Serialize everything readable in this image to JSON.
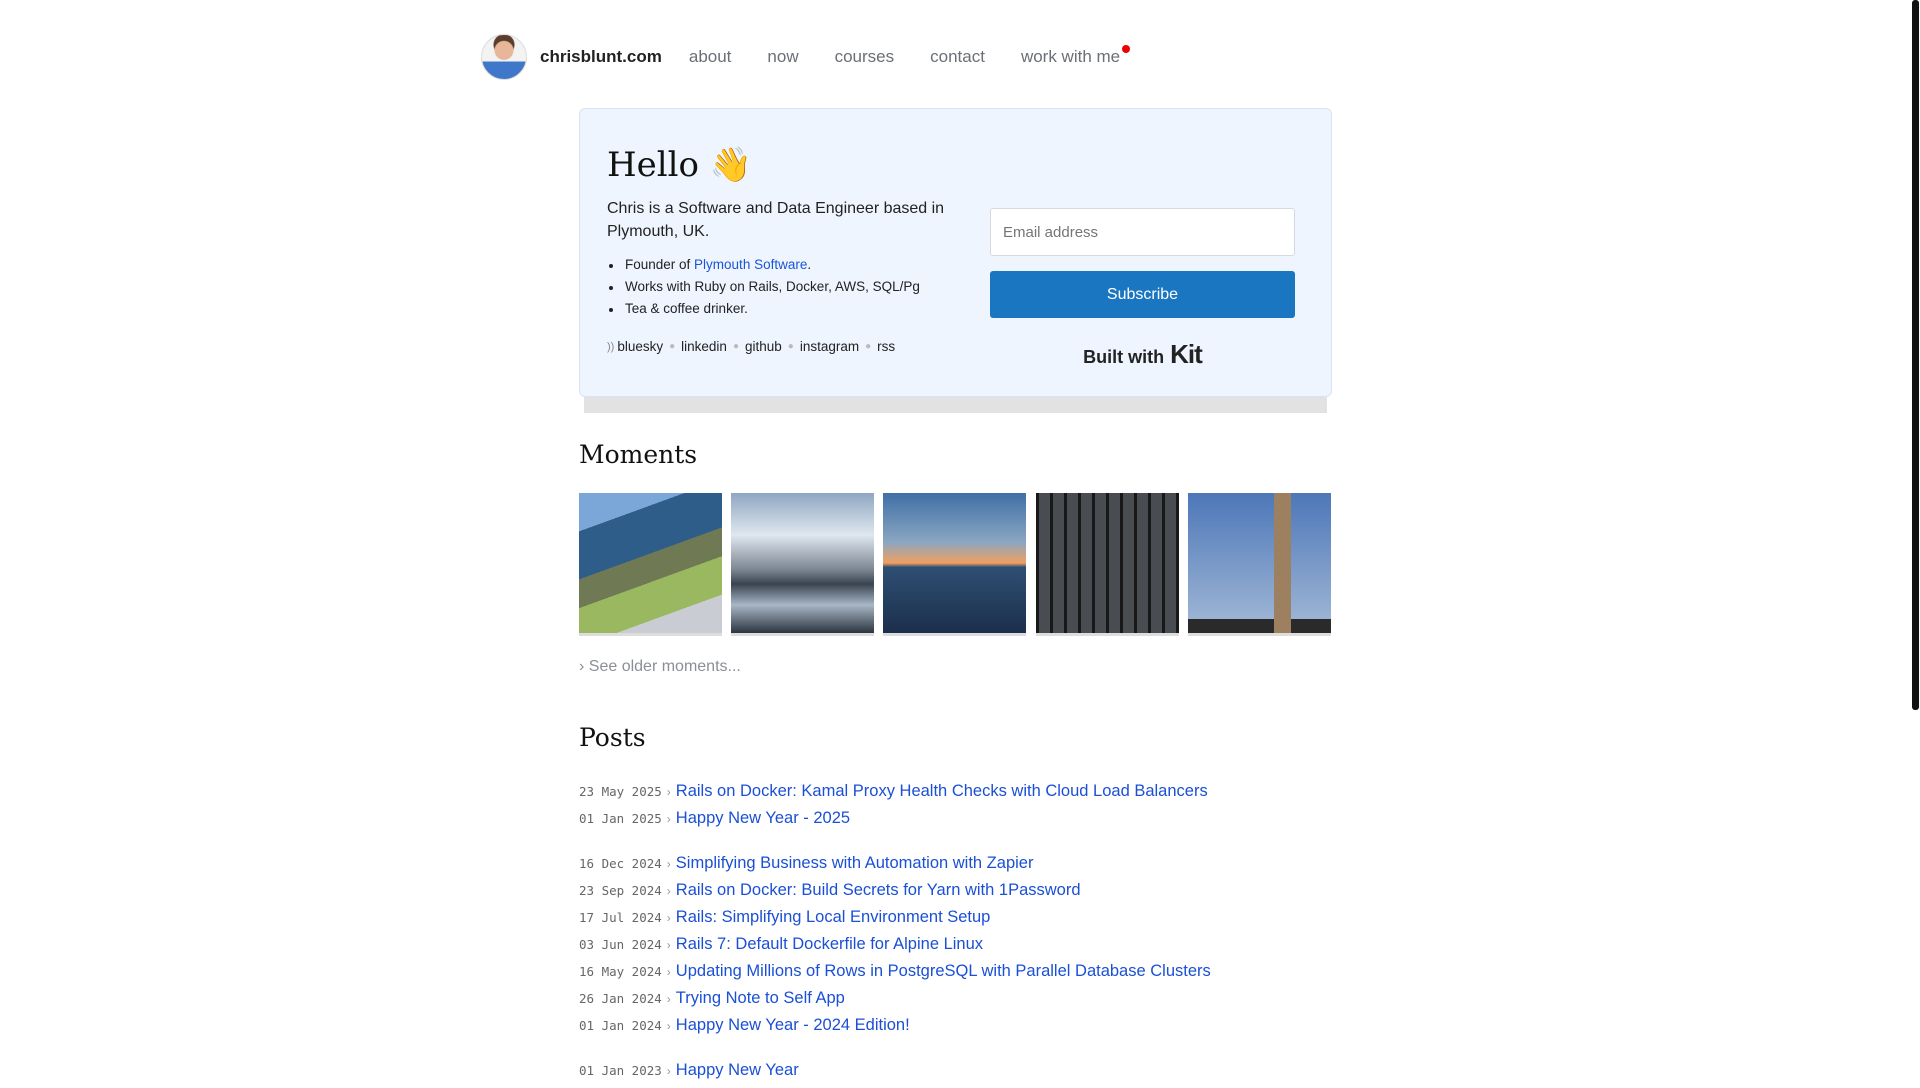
{
  "nav": {
    "brand": "chrisblunt.com",
    "links": [
      "about",
      "now",
      "courses",
      "contact",
      "work with me"
    ]
  },
  "intro": {
    "title": "Hello 👋",
    "bio": "Chris is a Software and Data Engineer based in Plymouth, UK.",
    "bullets": [
      {
        "prefix": "Founder of ",
        "link": "Plymouth Software",
        "suffix": "."
      },
      {
        "text": "Works with Ruby on Rails, Docker, AWS, SQL/Pg"
      },
      {
        "text": "Tea & coffee drinker."
      }
    ],
    "social": [
      "bluesky",
      "linkedin",
      "github",
      "instagram",
      "rss"
    ],
    "email_placeholder": "Email address",
    "subscribe": "Subscribe",
    "built_with": "Built with",
    "kit": "Kit"
  },
  "moments": {
    "title": "Moments",
    "images": [
      "coast-rocks-boat",
      "mountain-fjord",
      "sunset-sea",
      "station-roof",
      "clock-tower"
    ],
    "older": "› See older moments..."
  },
  "posts": {
    "title": "Posts",
    "items": [
      {
        "date": "23 May 2025",
        "title": "Rails on Docker: Kamal Proxy Health Checks with Cloud Load Balancers"
      },
      {
        "date": "01 Jan 2025",
        "title": "Happy New Year - 2025"
      },
      {
        "date": "16 Dec 2024",
        "title": "Simplifying Business with Automation with Zapier"
      },
      {
        "date": "23 Sep 2024",
        "title": "Rails on Docker: Build Secrets for Yarn with 1Password"
      },
      {
        "date": "17 Jul 2024",
        "title": "Rails: Simplifying Local Environment Setup"
      },
      {
        "date": "03 Jun 2024",
        "title": "Rails 7: Default Dockerfile for Alpine Linux"
      },
      {
        "date": "16 May 2024",
        "title": "Updating Millions of Rows in PostgreSQL with Parallel Database Clusters"
      },
      {
        "date": "26 Jan 2024",
        "title": "Trying Note to Self App"
      },
      {
        "date": "01 Jan 2024",
        "title": "Happy New Year - 2024 Edition!"
      },
      {
        "date": "01 Jan 2023",
        "title": "Happy New Year"
      }
    ]
  }
}
